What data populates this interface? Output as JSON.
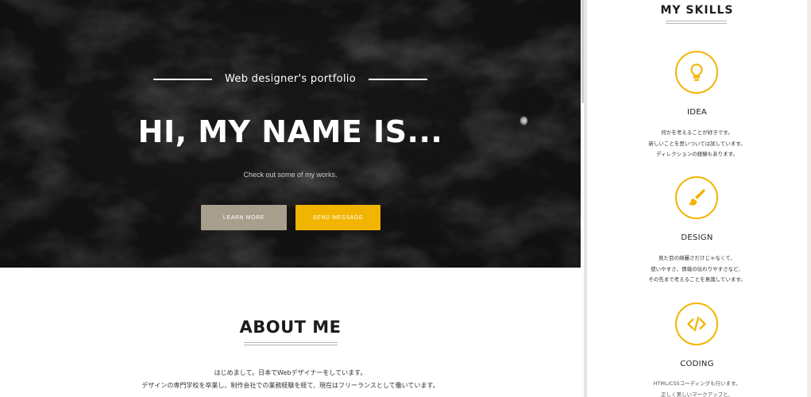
{
  "hero": {
    "subtitle": "Web designer's portfolio",
    "title": "HI, MY NAME IS...",
    "cta_text": "Check out some of my works.",
    "learn_more_label": "LEARN MORE",
    "send_message_label": "SEND MESSAGE"
  },
  "about": {
    "title": "ABOUT ME",
    "lines": [
      "はじめまして。日本でWebデザイナーをしています。",
      "デザインの専門学校を卒業し、制作会社での業務経験を経て、現在はフリーランスとして働いています。"
    ]
  },
  "skills": {
    "title": "MY SKILLS",
    "items": [
      {
        "name": "IDEA",
        "icon": "lightbulb-icon",
        "lines": [
          "何かを考えることが好きです。",
          "新しいことを思いついては試しています。",
          "ディレクションの経験もあります。"
        ]
      },
      {
        "name": "DESIGN",
        "icon": "paintbrush-icon",
        "lines": [
          "見た目の綺麗さだけじゃなくて、",
          "使いやすさ、情報の伝わりやすさなど、",
          "その先まで考えることを意識しています。"
        ]
      },
      {
        "name": "CODING",
        "icon": "code-icon",
        "lines": [
          "HTML/CSSコーディングも行います。",
          "正しく美しいマークアップと、"
        ]
      }
    ]
  },
  "colors": {
    "accent": "#f1b500",
    "learn_more_bg": "#a79f8c",
    "hero_bg": "#161616"
  }
}
